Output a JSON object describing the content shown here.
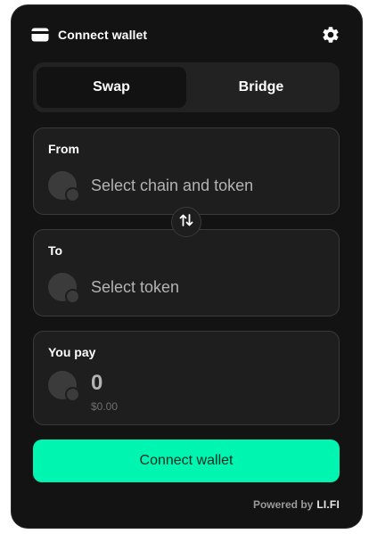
{
  "header": {
    "title": "Connect wallet",
    "wallet_icon": "wallet-icon",
    "settings_icon": "gear-icon"
  },
  "tabs": [
    {
      "label": "Swap",
      "active": true
    },
    {
      "label": "Bridge",
      "active": false
    }
  ],
  "from": {
    "label": "From",
    "placeholder": "Select chain and token"
  },
  "swap_direction_icon": "swap-arrows-icon",
  "to": {
    "label": "To",
    "placeholder": "Select token"
  },
  "pay": {
    "label": "You pay",
    "amount": "0",
    "fiat": "$0.00"
  },
  "connect_button": {
    "label": "Connect wallet",
    "color": "#00f6b0"
  },
  "footer": {
    "powered_by": "Powered by",
    "brand": "LI.FI"
  },
  "colors": {
    "background": "#131313",
    "card": "#1e1e1e",
    "accent": "#00f6b0"
  }
}
